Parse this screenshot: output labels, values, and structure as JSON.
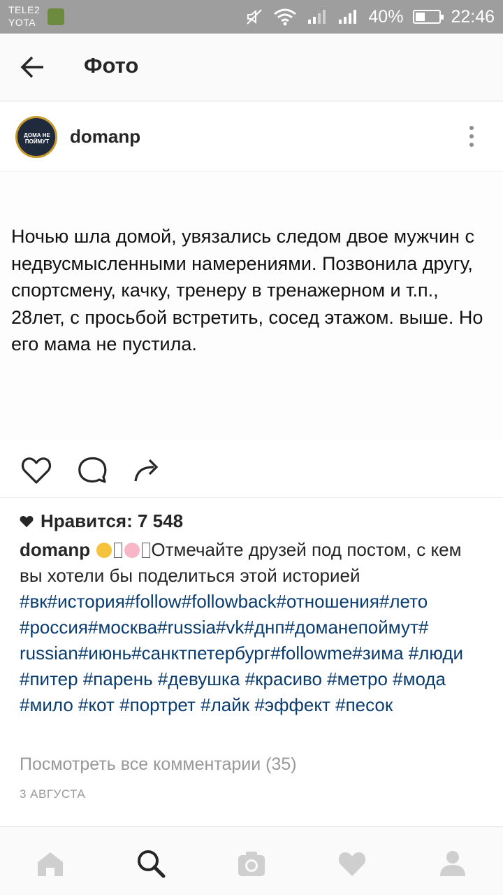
{
  "status_bar": {
    "carrier1": "TELE2",
    "carrier2": "YOTA",
    "battery": "40%",
    "battery_level": 0.4,
    "time": "22:46"
  },
  "header": {
    "title": "Фото"
  },
  "post": {
    "username": "domanp",
    "avatar_text": "ДОМА НЕ ПОЙМУТ",
    "photo_text": "Ночью шла домой, увязались следом двое мужчин с недвусмысленными намерениями. Позвонила другу, спортсмену, качку, тренеру в тренажерном и т.п., 28лет, с просьбой встретить, сосед этажом. выше. Но его мама не пустила.",
    "likes_label": "Нравится: 7 548",
    "caption_user": "domanp",
    "caption_text": "Отмечайте друзей под постом, с кем вы хотели бы поделиться этой историей",
    "hashtags": "#вк#история#follow#followback#отношения#лето #россия#москва#russia#vk#днп#доманепоймут# russian#июнь#санктпетербург#followme#зима #люди #питер #парень #девушка #красиво #метро #мода #мило #кот #портрет #лайк #эффект #песок",
    "view_comments": "Посмотреть все комментарии (35)",
    "date": "3 АВГУСТА"
  },
  "icons": {
    "back": "arrow-left-icon",
    "more": "more-vertical-icon",
    "like": "heart-outline-icon",
    "comment": "comment-icon",
    "share": "share-icon",
    "nav": [
      "home-icon",
      "search-icon",
      "camera-icon",
      "heart-icon",
      "profile-icon"
    ]
  },
  "colors": {
    "status_bar": "#9e9e9e",
    "hashtag": "#0b3c6f",
    "muted": "#999999"
  }
}
